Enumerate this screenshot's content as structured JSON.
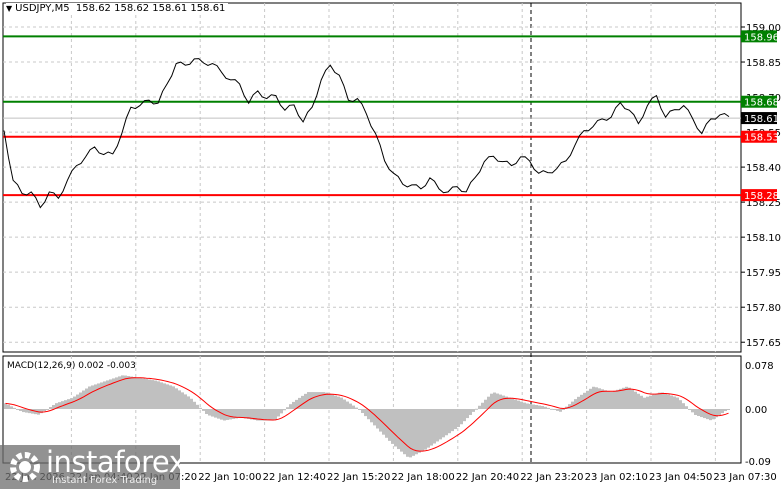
{
  "header": {
    "symbol": "USDJPY,M5",
    "ohlc": "158.62 158.62 158.61 158.61"
  },
  "colors": {
    "support": "#ff0000",
    "resistance": "#008000",
    "price": "#000000",
    "histogram": "#c0c0c0",
    "signal": "#ff0000"
  },
  "chart_data": {
    "type": "line",
    "title": "USDJPY,M5",
    "price_axis": {
      "ticks": [
        "159.00",
        "158.85",
        "158.70",
        "158.55",
        "158.40",
        "158.25",
        "158.10",
        "157.95",
        "157.80",
        "157.65"
      ],
      "ylim": [
        157.62,
        159.03
      ]
    },
    "levels": [
      {
        "label": "158.96",
        "value": 158.96,
        "kind": "resistance"
      },
      {
        "label": "158.68",
        "value": 158.68,
        "kind": "resistance"
      },
      {
        "label": "158.53",
        "value": 158.53,
        "kind": "support"
      },
      {
        "label": "158.28",
        "value": 158.28,
        "kind": "support"
      }
    ],
    "current_price": {
      "label": "158.61",
      "value": 158.61
    },
    "time_labels": [
      "22 Jan 2026",
      "22 Jan 04:40",
      "22 Jan 07:20",
      "22 Jan 10:00",
      "22 Jan 12:40",
      "22 Jan 15:20",
      "22 Jan 18:00",
      "22 Jan 20:40",
      "22 Jan 23:20",
      "23 Jan 02:10",
      "23 Jan 04:50",
      "23 Jan 07:30"
    ],
    "price_series": [
      158.55,
      158.35,
      158.28,
      158.3,
      158.22,
      158.3,
      158.26,
      158.35,
      158.4,
      158.45,
      158.48,
      158.46,
      158.45,
      158.55,
      158.65,
      158.67,
      158.68,
      158.68,
      158.75,
      158.85,
      158.83,
      158.87,
      158.84,
      158.85,
      158.8,
      158.78,
      158.75,
      158.68,
      158.72,
      158.7,
      158.7,
      158.65,
      158.66,
      158.6,
      158.65,
      158.78,
      158.83,
      158.8,
      158.68,
      158.7,
      158.62,
      158.55,
      158.42,
      158.38,
      158.32,
      158.33,
      158.3,
      158.36,
      158.3,
      158.3,
      158.31,
      158.3,
      158.35,
      158.43,
      158.44,
      158.43,
      158.4,
      158.45,
      158.42,
      158.38,
      158.37,
      158.4,
      158.42,
      158.5,
      158.55,
      158.58,
      158.6,
      158.62,
      158.67,
      158.65,
      158.58,
      158.67,
      158.7,
      158.62,
      158.64,
      158.67,
      158.6,
      158.55,
      158.6,
      158.63,
      158.61
    ],
    "macd": {
      "label": "MACD(12,26,9) 0.002 -0.003",
      "ticks": [
        "0.078",
        "0.00",
        "-0.09"
      ],
      "ylim": [
        -0.09,
        0.078
      ],
      "histogram": [
        0.01,
        -0.005,
        -0.01,
        0.01,
        0.02,
        0.04,
        0.05,
        0.06,
        0.055,
        0.05,
        0.04,
        0.02,
        -0.01,
        -0.02,
        -0.015,
        -0.02,
        -0.02,
        0.01,
        0.03,
        0.03,
        0.02,
        0.0,
        -0.03,
        -0.06,
        -0.085,
        -0.07,
        -0.05,
        -0.03,
        0.0,
        0.03,
        0.02,
        0.01,
        0.005,
        -0.005,
        0.02,
        0.04,
        0.03,
        0.04,
        0.02,
        0.03,
        0.02,
        -0.01,
        -0.02,
        0.0
      ]
    }
  },
  "watermark": {
    "brand": "instaforex",
    "tagline": "Instant Forex Trading"
  }
}
